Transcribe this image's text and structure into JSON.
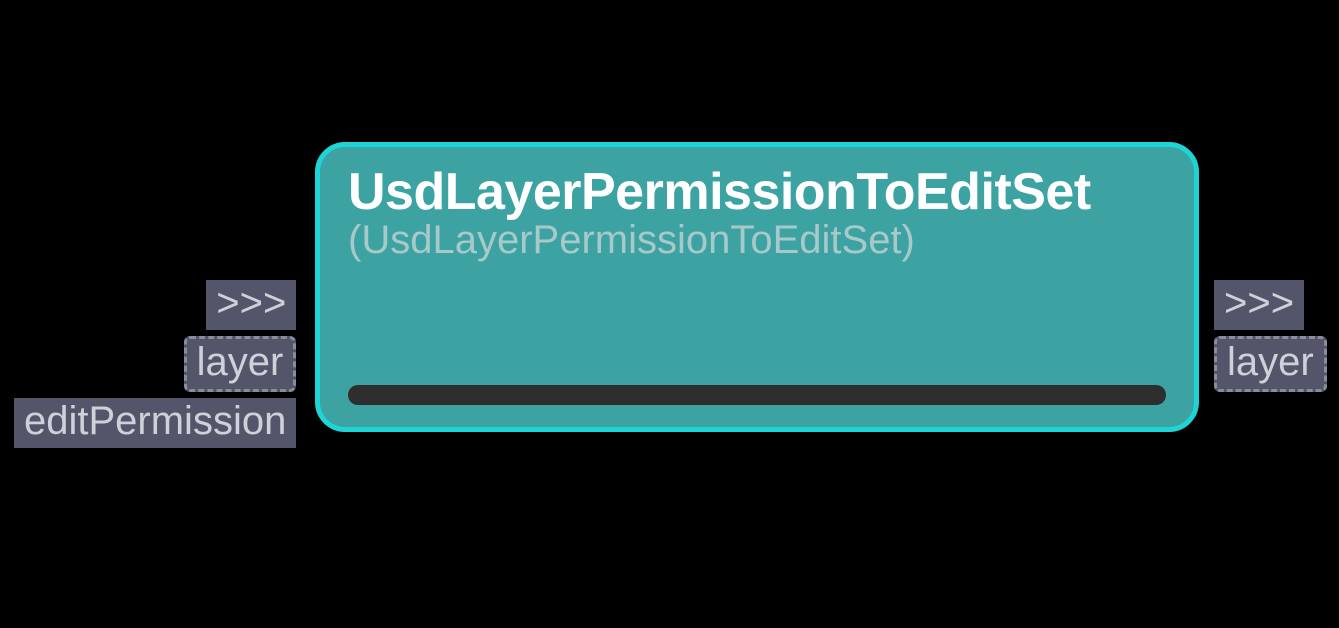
{
  "node": {
    "title": "UsdLayerPermissionToEditSet",
    "subtitle": "(UsdLayerPermissionToEditSet)"
  },
  "ports": {
    "left": [
      {
        "label": ">>>",
        "dashed": false
      },
      {
        "label": "layer",
        "dashed": true
      },
      {
        "label": "editPermission",
        "dashed": false
      }
    ],
    "right": [
      {
        "label": ">>>",
        "dashed": false
      },
      {
        "label": "layer",
        "dashed": true
      }
    ]
  }
}
